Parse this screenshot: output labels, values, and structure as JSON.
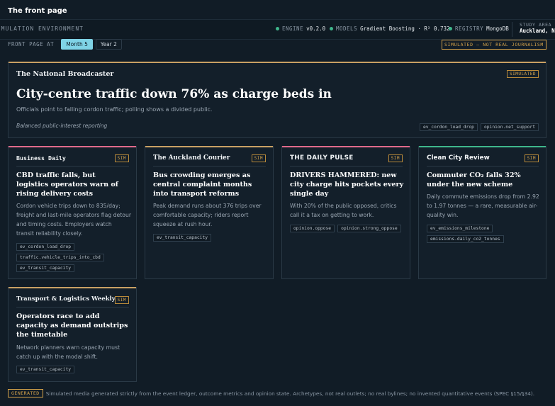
{
  "page": {
    "title": "The front page"
  },
  "topbar": {
    "env_label": "SIMULATION ENVIRONMENT",
    "engine_key": "ENGINE",
    "engine_value": "v0.2.0",
    "models_key": "MODELS",
    "models_value": "Gradient Boosting · R² 0.732",
    "registry_key": "REGISTRY",
    "registry_value": "MongoDB",
    "study_key": "STUDY AREA",
    "study_value": "Auckland, NZ",
    "status_color": "#3fb68b"
  },
  "controls": {
    "label": "FRONT PAGE AT",
    "options": [
      "Month 5",
      "Year 2"
    ],
    "selected": "Month 5"
  },
  "disclaimer": "SIMULATED — NOT REAL JOURNALISM",
  "lead": {
    "outlet": "The National Broadcaster",
    "badge": "SIMULATED",
    "headline": "City-centre traffic down 76% as charge beds in",
    "dek": "Officials point to falling cordon traffic; polling shows a divided public.",
    "tone": "Balanced public-interest reporting",
    "tags": [
      "ev_cordon_load_drop",
      "opinion.net_support"
    ],
    "accent": "#c9a063"
  },
  "cards": [
    {
      "outlet": "Business Daily",
      "badge": "SIM",
      "accent": "#e06a8a",
      "headline": "CBD traffic falls, but logistics operators warn of rising delivery costs",
      "body": "Cordon vehicle trips down to 835/day; freight and last-mile operators flag detour and timing costs. Employers watch transit reliability closely.",
      "tags": [
        "ev_cordon_load_drop",
        "traffic.vehicle_trips_into_cbd",
        "ev_transit_capacity"
      ]
    },
    {
      "outlet": "The Auckland Courier",
      "badge": "SIM",
      "accent": "#c9a063",
      "headline": "Bus crowding emerges as central complaint months into transport reforms",
      "body": "Peak demand runs about 376 trips over comfortable capacity; riders report squeeze at rush hour.",
      "tags": [
        "ev_transit_capacity"
      ]
    },
    {
      "outlet": "THE DAILY PULSE",
      "badge": "SIM",
      "accent": "#e06a8a",
      "headline": "DRIVERS HAMMERED: new city charge hits pockets every single day",
      "body": "With 20% of the public opposed, critics call it a tax on getting to work.",
      "tags": [
        "opinion.oppose",
        "opinion.strong_oppose"
      ]
    },
    {
      "outlet": "Clean City Review",
      "badge": "SIM",
      "accent": "#3fb68b",
      "headline": "Commuter CO₂ falls 32% under the new scheme",
      "body": "Daily commute emissions drop from 2.92 to 1.97 tonnes — a rare, measurable air-quality win.",
      "tags": [
        "ev_emissions_milestone",
        "emissions.daily_co2_tonnes"
      ]
    },
    {
      "outlet": "Transport & Logistics Weekly",
      "badge": "SIM",
      "accent": "#c9a063",
      "headline": "Operators race to add capacity as demand outstrips the timetable",
      "body": "Network planners warn capacity must catch up with the modal shift.",
      "tags": [
        "ev_transit_capacity"
      ]
    }
  ],
  "footer": {
    "badge": "GENERATED",
    "note": "Simulated media generated strictly from the event ledger, outcome metrics and opinion state. Archetypes, not real outlets; no real bylines; no invented quantitative events (SPEC §15/§34)."
  }
}
